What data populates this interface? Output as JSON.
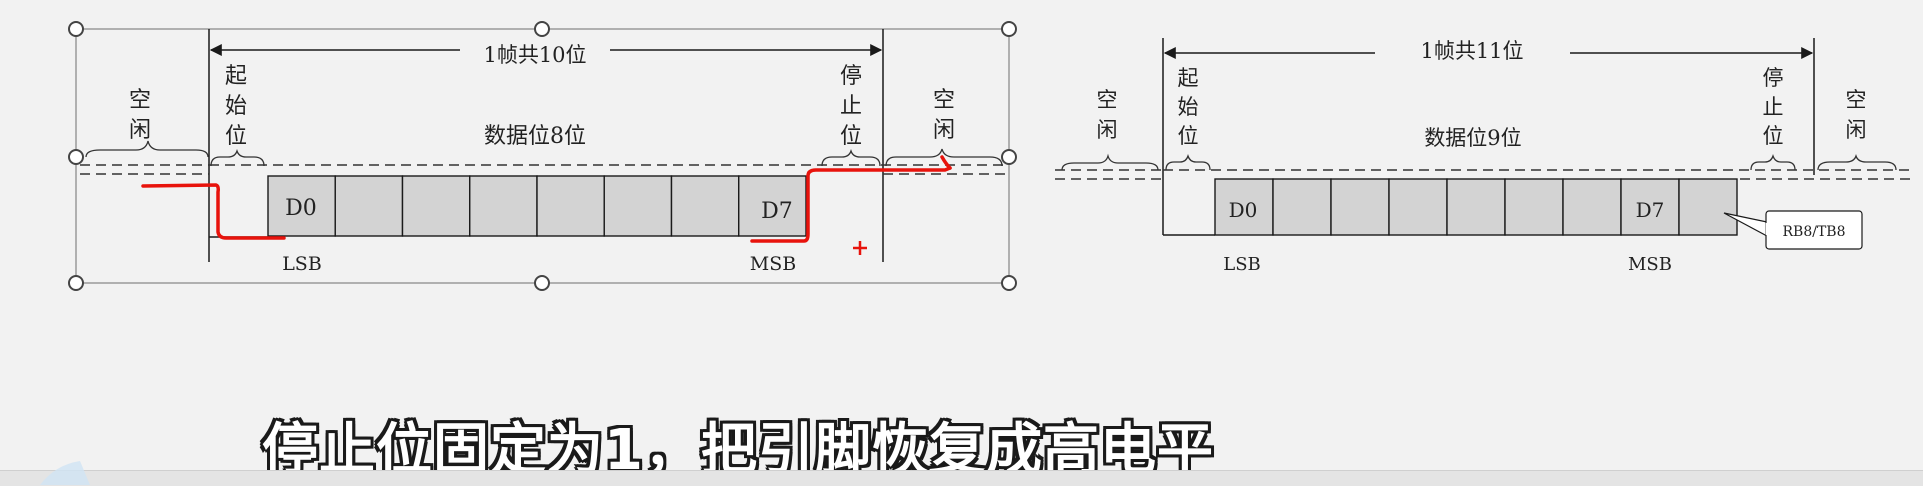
{
  "diagram_left": {
    "frame_label": "1帧共10位",
    "idle_left": "空\n闲",
    "start_bit": "起\n始\n位",
    "data_bits": "数据位8位",
    "stop_bit": "停\n止\n位",
    "idle_right": "空\n闲",
    "first_cell": "D0",
    "last_cell": "D7",
    "lsb": "LSB",
    "msb": "MSB",
    "cell_count": 8,
    "annotation_color": "#e8130c"
  },
  "diagram_right": {
    "frame_label": "1帧共11位",
    "idle_left": "空\n闲",
    "start_bit": "起\n始\n位",
    "data_bits": "数据位9位",
    "stop_bit": "停\n止\n位",
    "idle_right": "空\n闲",
    "first_cell": "D0",
    "last_cell": "D7",
    "lsb": "LSB",
    "msb": "MSB",
    "callout": "RB8/TB8",
    "cell_count": 9
  },
  "subtitle": "停止位固定为1，把引脚恢复成高电平",
  "colors": {
    "cell_fill": "#d3d3d3",
    "line": "#1a1a1a",
    "handle": "#444444",
    "background": "#f2f2f2"
  }
}
